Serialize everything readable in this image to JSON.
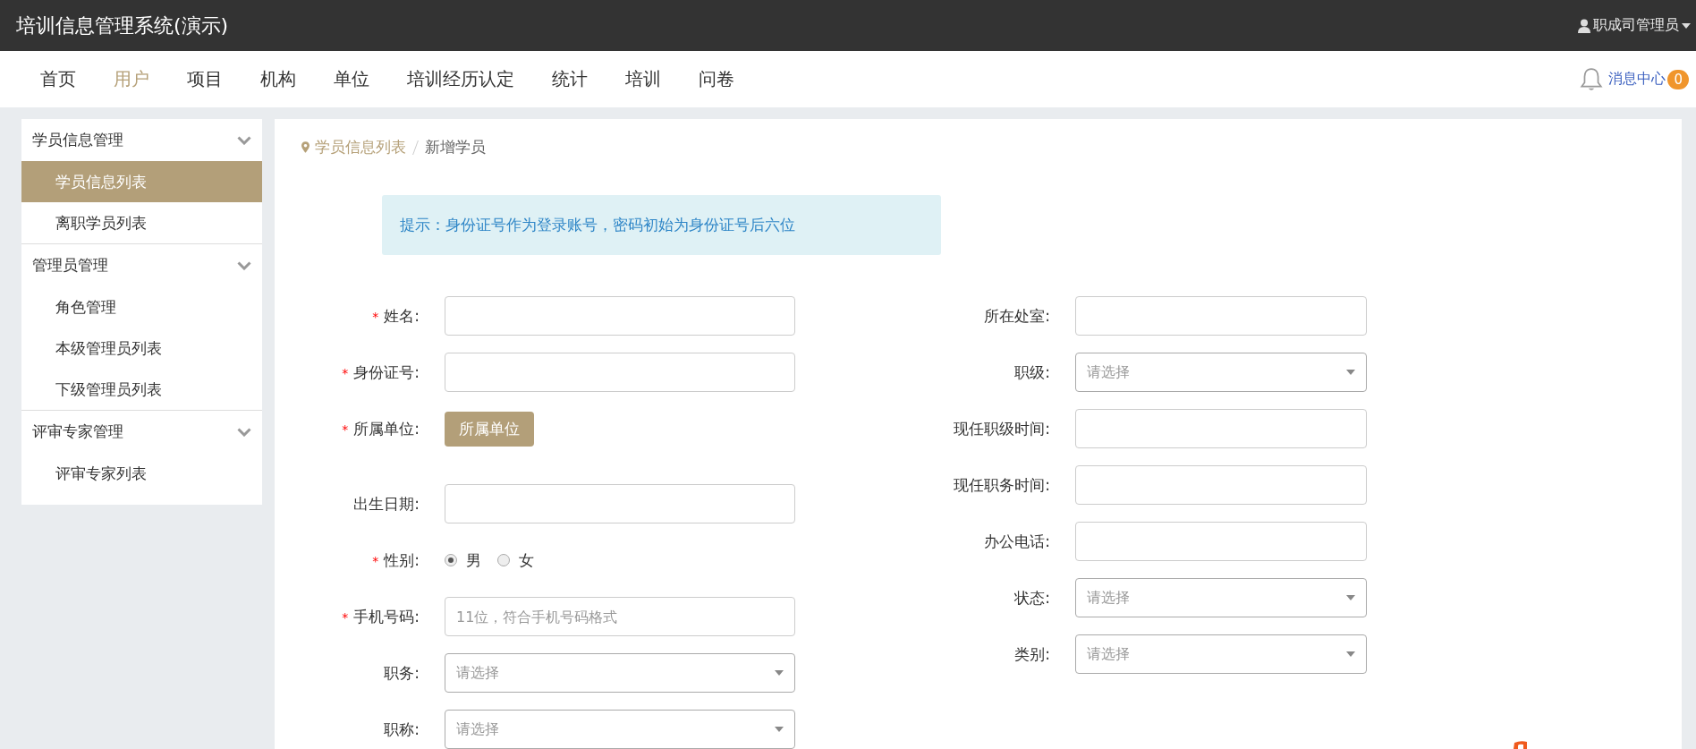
{
  "app_title": "培训信息管理系统(演示)",
  "user_menu": {
    "label": "职成司管理员"
  },
  "nav": [
    {
      "label": "首页",
      "selected": false
    },
    {
      "label": "用户",
      "selected": true
    },
    {
      "label": "项目",
      "selected": false
    },
    {
      "label": "机构",
      "selected": false
    },
    {
      "label": "单位",
      "selected": false
    },
    {
      "label": "培训经历认定",
      "selected": false
    },
    {
      "label": "统计",
      "selected": false
    },
    {
      "label": "培训",
      "selected": false
    },
    {
      "label": "问卷",
      "selected": false
    }
  ],
  "messages": {
    "label": "消息中心",
    "count": "0"
  },
  "sidebar": [
    {
      "label": "学员信息管理",
      "children": [
        {
          "label": "学员信息列表",
          "selected": true
        },
        {
          "label": "离职学员列表",
          "selected": false
        }
      ]
    },
    {
      "label": "管理员管理",
      "children": [
        {
          "label": "角色管理",
          "selected": false
        },
        {
          "label": "本级管理员列表",
          "selected": false
        },
        {
          "label": "下级管理员列表",
          "selected": false
        }
      ]
    },
    {
      "label": "评审专家管理",
      "children": [
        {
          "label": "评审专家列表",
          "selected": false
        }
      ]
    }
  ],
  "breadcrumb": [
    "学员信息列表",
    "新增学员"
  ],
  "notice": "提示：身份证号作为登录账号，密码初始为身份证号后六位",
  "form_left": [
    {
      "kind": "text",
      "label": "姓名:",
      "mark": "*"
    },
    {
      "kind": "text",
      "label": "身份证号:",
      "mark": "*"
    },
    {
      "kind": "button",
      "label": "所属单位:",
      "mark": "*",
      "button": "所属单位"
    },
    {
      "kind": "text",
      "label": "出生日期:"
    },
    {
      "kind": "radio",
      "label": "性别:",
      "mark": "*",
      "options": [
        {
          "label": "男",
          "selected": true
        },
        {
          "label": "女",
          "selected": false
        }
      ]
    },
    {
      "kind": "text",
      "label": "手机号码:",
      "mark": "*",
      "placeholder": "11位，符合手机号码格式"
    },
    {
      "kind": "select",
      "label": "职务:",
      "placeholder": "请选择"
    },
    {
      "kind": "select",
      "label": "职称:",
      "placeholder": "请选择"
    }
  ],
  "form_right": [
    {
      "kind": "text",
      "label": "所在处室:"
    },
    {
      "kind": "select",
      "label": "职级:",
      "placeholder": "请选择"
    },
    {
      "kind": "text",
      "label": "现任职级时间:"
    },
    {
      "kind": "text",
      "label": "现任职务时间:"
    },
    {
      "kind": "text",
      "label": "办公电话:"
    },
    {
      "kind": "select",
      "label": "状态:",
      "placeholder": "请选择"
    },
    {
      "kind": "select",
      "label": "类别:",
      "placeholder": "请选择"
    }
  ]
}
